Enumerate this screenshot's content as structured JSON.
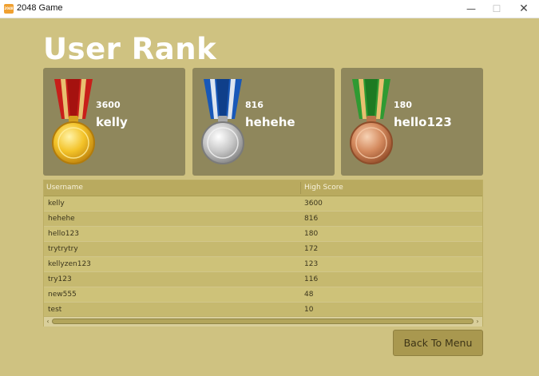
{
  "window": {
    "title": "2048 Game",
    "icon_label": "2048",
    "minimize_glyph": "—",
    "maximize_glyph": "☐",
    "close_glyph": "✕"
  },
  "page": {
    "title": "User Rank"
  },
  "podium": [
    {
      "rank": 1,
      "medal": "gold-medal-icon",
      "ribbon_color": "#d42a1f",
      "medal_color": "#f3c329",
      "score": "3600",
      "username": "kelly"
    },
    {
      "rank": 2,
      "medal": "silver-medal-icon",
      "ribbon_color": "#1858b8",
      "medal_color": "#c8c8c8",
      "score": "816",
      "username": "hehehe"
    },
    {
      "rank": 3,
      "medal": "bronze-medal-icon",
      "ribbon_color": "#2f9a32",
      "medal_color": "#d48a5e",
      "score": "180",
      "username": "hello123"
    }
  ],
  "table": {
    "columns": [
      "Username",
      "High Score"
    ],
    "rows": [
      [
        "kelly",
        "3600"
      ],
      [
        "hehehe",
        "816"
      ],
      [
        "hello123",
        "180"
      ],
      [
        "trytrytry",
        "172"
      ],
      [
        "kellyzen123",
        "123"
      ],
      [
        "try123",
        "116"
      ],
      [
        "new555",
        "48"
      ],
      [
        "test",
        "10"
      ]
    ],
    "scroll_left_glyph": "‹",
    "scroll_right_glyph": "›"
  },
  "actions": {
    "back_label": "Back To Menu"
  },
  "colors": {
    "background": "#cfc281",
    "card": "#8f875c",
    "button": "#a9984f"
  }
}
